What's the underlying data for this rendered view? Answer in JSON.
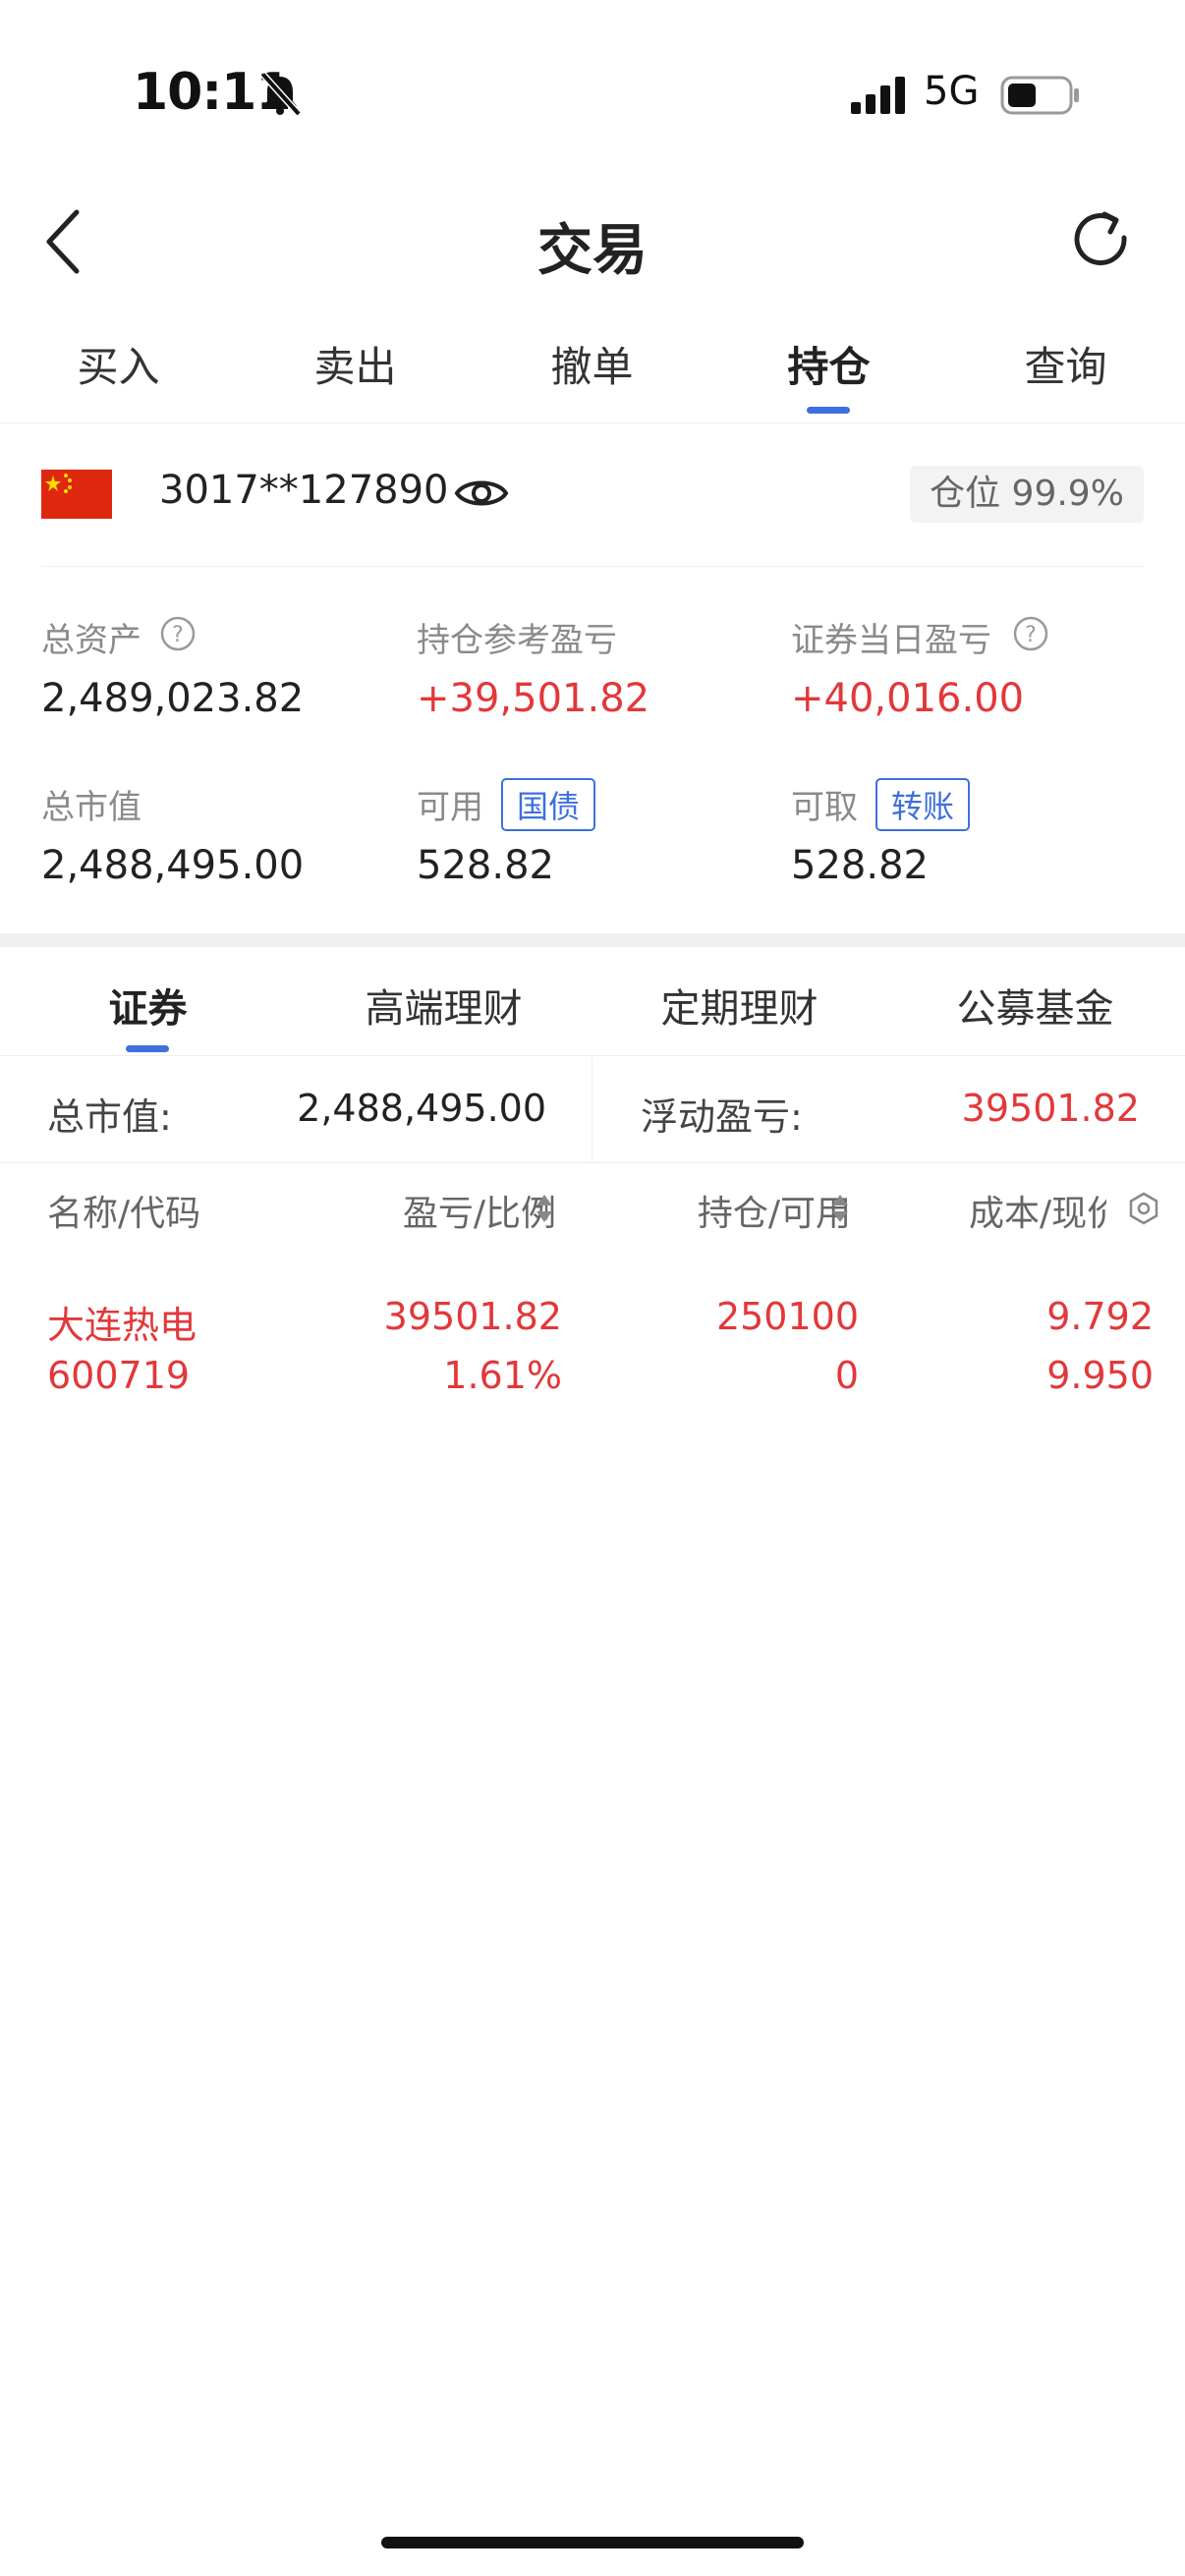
{
  "status_bar": {
    "time": "10:11",
    "network": "5G"
  },
  "nav": {
    "title": "交易"
  },
  "main_tabs": [
    "买入",
    "卖出",
    "撤单",
    "持仓",
    "查询"
  ],
  "account": {
    "number": "3017**127890",
    "position_label": "仓位 99.9%"
  },
  "stats": {
    "total_assets": {
      "label": "总资产",
      "value": "2,489,023.82"
    },
    "position_pnl": {
      "label": "持仓参考盈亏",
      "value": "+39,501.82"
    },
    "today_pnl": {
      "label": "证券当日盈亏",
      "value": "+40,016.00"
    },
    "market_value": {
      "label": "总市值",
      "value": "2,488,495.00"
    },
    "available": {
      "label": "可用",
      "tag": "国债",
      "value": "528.82"
    },
    "withdrawable": {
      "label": "可取",
      "tag": "转账",
      "value": "528.82"
    }
  },
  "sub_tabs": [
    "证券",
    "高端理财",
    "定期理财",
    "公募基金"
  ],
  "summary": {
    "market_value_label": "总市值:",
    "market_value": "2,488,495.00",
    "floating_pnl_label": "浮动盈亏:",
    "floating_pnl": "39501.82"
  },
  "table": {
    "headers": [
      "名称/代码",
      "盈亏/比例",
      "持仓/可用",
      "成本/现价"
    ],
    "rows": [
      {
        "name": "大连热电",
        "code": "600719",
        "pnl": "39501.82",
        "ratio": "1.61%",
        "position": "250100",
        "available": "0",
        "cost": "9.792",
        "price": "9.950"
      }
    ]
  },
  "colors": {
    "accent": "#3e6fdc",
    "gain": "#e2383a"
  }
}
